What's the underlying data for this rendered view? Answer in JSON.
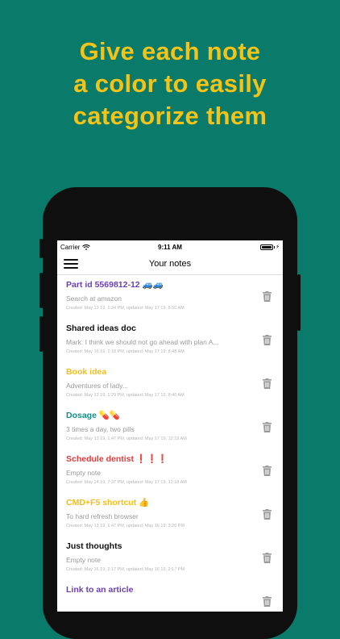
{
  "headline": {
    "line1": "Give each note",
    "line2": "a color to easily",
    "line3": "categorize them"
  },
  "status_bar": {
    "carrier": "Carrier",
    "time": "9:11 AM"
  },
  "nav": {
    "title": "Your notes",
    "menu_icon": "hamburger-menu-icon"
  },
  "notes": [
    {
      "title": "Part id 5569812-12 🚙🚙",
      "color": "#6a3fb6",
      "body": "Search at amazon",
      "meta": "Created: May 13 19, 1:34 PM, updated: May 17 19, 8:50 AM"
    },
    {
      "title": "Shared ideas doc",
      "color": "#111111",
      "body": "Mark: I think we should not go ahead with plan A...",
      "meta": "Created: May 16 19, 2:18 PM, updated: May 17 19, 8:48 AM"
    },
    {
      "title": "Book idea",
      "color": "#f2be19",
      "body": "Adventures of lady...",
      "meta": "Created: May 13 19, 1:29 PM, updated: May 17 19, 8:40 AM"
    },
    {
      "title": "Dosage 💊💊",
      "color": "#138f85",
      "body": "3 times a day, two pills",
      "meta": "Created: May 13 19, 1:47 PM, updated: May 17 19, 12:19 AM"
    },
    {
      "title": "Schedule dentist ❗❗❗",
      "color": "#e23a3a",
      "body": "Empty note",
      "meta": "Created: May 14 19, 7:37 PM, updated: May 17 19, 12:18 AM"
    },
    {
      "title": "CMD+F5 shortcut 👍",
      "color": "#f2be19",
      "body": "To hard refresh browser",
      "meta": "Created: May 13 19, 1:47 PM, updated: May 16 19, 3:26 PM"
    },
    {
      "title": "Just thoughts",
      "color": "#111111",
      "body": "Empty note",
      "meta": "Created: May 16 19, 2:17 PM, updated: May 16 19, 2:17 PM"
    },
    {
      "title": "Link to an article",
      "color": "#6a3fb6",
      "body": "",
      "meta": ""
    }
  ],
  "icons": {
    "trash": "trash-icon",
    "wifi": "wifi-icon",
    "battery": "battery-icon"
  }
}
